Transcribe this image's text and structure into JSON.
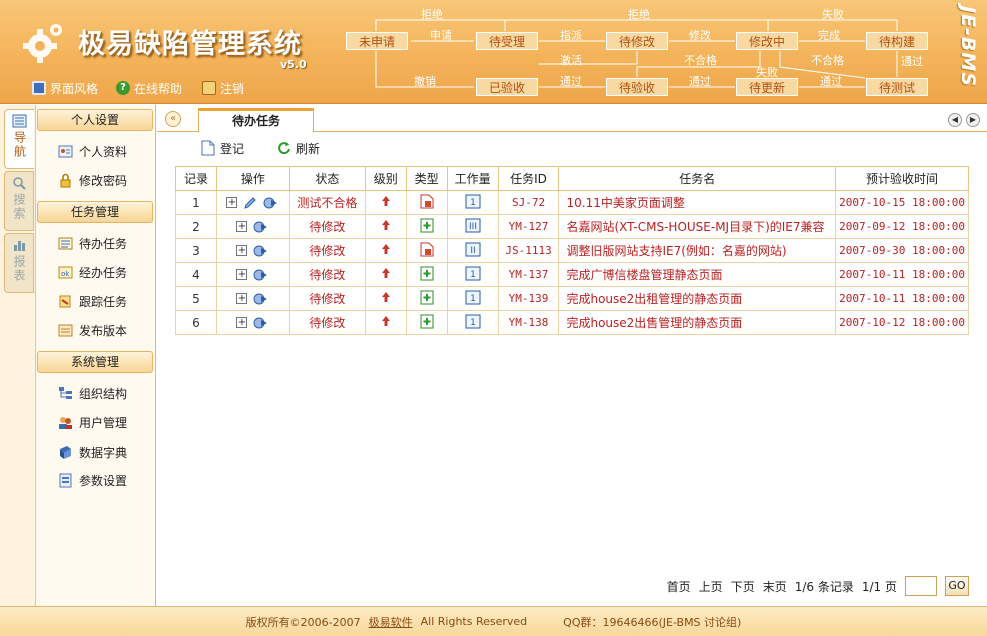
{
  "header": {
    "title": "极易缺陷管理系统",
    "version": "v5.0",
    "brand": "JE-BMS",
    "links": [
      {
        "label": "界面风格",
        "icon": "grid-icon"
      },
      {
        "label": "在线帮助",
        "icon": "help-icon"
      },
      {
        "label": "注销",
        "icon": "logout-icon"
      }
    ]
  },
  "flow": {
    "nodes": {
      "unsubmitted": "未申请",
      "pending_accept": "待受理",
      "pending_fix": "待修改",
      "fixing": "修改中",
      "pending_build": "待构建",
      "accepted": "已验收",
      "pending_check": "待验收",
      "pending_update": "待更新",
      "pending_test": "待测试"
    },
    "labels": {
      "reject1": "拒绝",
      "reject2": "拒绝",
      "fail1": "失败",
      "apply": "申请",
      "assign": "指派",
      "modify": "修改",
      "done": "完成",
      "activate": "激活",
      "unqualified1": "不合格",
      "unqualified2": "不合格",
      "pass_build": "通过",
      "revoke": "撤销",
      "pass1": "通过",
      "pass2": "通过",
      "fail2": "失败",
      "pass3": "通过"
    }
  },
  "vtabs": [
    {
      "label": "导航",
      "icon": "navigation-icon"
    },
    {
      "label": "搜索",
      "icon": "search-icon"
    },
    {
      "label": "报表",
      "icon": "report-icon"
    }
  ],
  "sidebar": {
    "sections": [
      {
        "title": "个人设置",
        "items": [
          {
            "label": "个人资料",
            "icon": "profile-card-icon"
          },
          {
            "label": "修改密码",
            "icon": "lock-icon"
          }
        ]
      },
      {
        "title": "任务管理",
        "items": [
          {
            "label": "待办任务",
            "icon": "todo-list-icon"
          },
          {
            "label": "经办任务",
            "icon": "handled-task-icon"
          },
          {
            "label": "跟踪任务",
            "icon": "track-task-icon"
          },
          {
            "label": "发布版本",
            "icon": "release-icon"
          }
        ]
      },
      {
        "title": "系统管理",
        "items": [
          {
            "label": "组织结构",
            "icon": "org-chart-icon"
          },
          {
            "label": "用户管理",
            "icon": "users-icon"
          },
          {
            "label": "数据字典",
            "icon": "dictionary-icon"
          },
          {
            "label": "参数设置",
            "icon": "settings-icon"
          }
        ]
      }
    ]
  },
  "main": {
    "tab": "待办任务",
    "toolbar": {
      "register": "登记",
      "refresh": "刷新"
    },
    "columns": [
      "记录",
      "操作",
      "状态",
      "级别",
      "类型",
      "工作量",
      "任务ID",
      "任务名",
      "预计验收时间"
    ],
    "rows": [
      {
        "no": "1",
        "status": "测试不合格",
        "id": "SJ-72",
        "name": "10.11中美家页面调整",
        "time": "2007-10-15 18:00:00",
        "type": "doc-red",
        "work": "1",
        "extra_op": true
      },
      {
        "no": "2",
        "status": "待修改",
        "id": "YM-127",
        "name": "名嘉网站(XT-CMS-HOUSE-MJ目录下)的IE7兼容",
        "time": "2007-09-12 18:00:00",
        "type": "plus-green",
        "work": "III",
        "extra_op": false
      },
      {
        "no": "3",
        "status": "待修改",
        "id": "JS-1113",
        "name": "调整旧版网站支持IE7(例如：名嘉的网站)",
        "time": "2007-09-30 18:00:00",
        "type": "doc-red",
        "work": "II",
        "extra_op": false
      },
      {
        "no": "4",
        "status": "待修改",
        "id": "YM-137",
        "name": "完成广博信楼盘管理静态页面",
        "time": "2007-10-11 18:00:00",
        "type": "plus-green",
        "work": "1",
        "extra_op": false
      },
      {
        "no": "5",
        "status": "待修改",
        "id": "YM-139",
        "name": "完成house2出租管理的静态页面",
        "time": "2007-10-11 18:00:00",
        "type": "plus-green",
        "work": "1",
        "extra_op": false
      },
      {
        "no": "6",
        "status": "待修改",
        "id": "YM-138",
        "name": "完成house2出售管理的静态页面",
        "time": "2007-10-12 18:00:00",
        "type": "plus-green",
        "work": "1",
        "extra_op": false
      }
    ],
    "pager": {
      "first": "首页",
      "prev": "上页",
      "next": "下页",
      "last": "末页",
      "records": "1/6 条记录",
      "pages": "1/1 页",
      "go": "GO"
    }
  },
  "footer": {
    "copyright": "版权所有©2006-2007",
    "company": "极易软件",
    "rights": "All Rights Reserved",
    "qq": "QQ群：19646466(JE-BMS 讨论组)"
  },
  "colors": {
    "accent": "#f4b35a",
    "text_red": "#bb2222",
    "node_text": "#b5500d"
  }
}
